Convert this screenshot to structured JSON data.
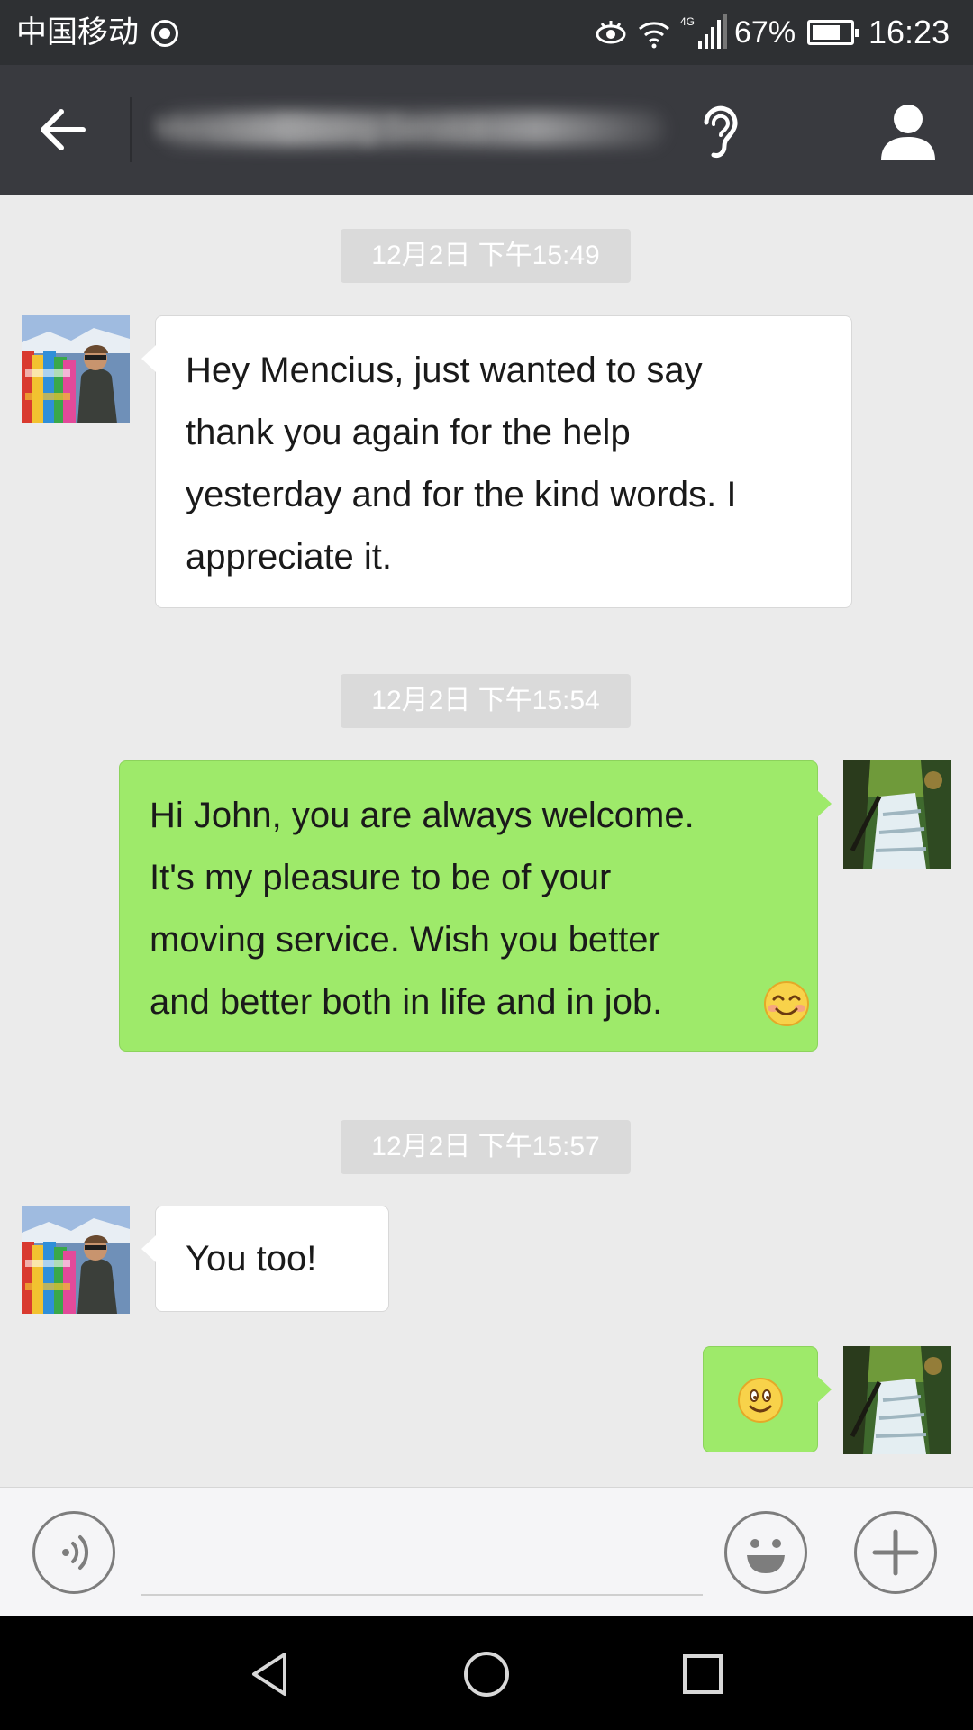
{
  "status_bar": {
    "carrier": "中国移动",
    "network": "4G",
    "battery": "67%",
    "time": "16:23"
  },
  "header": {
    "title": "Mencius Moving Service"
  },
  "messages": [
    {
      "timestamp": "12月2日 下午15:49",
      "from": "John",
      "side": "left",
      "text": "Hey Mencius, just wanted to say\nthank you again for the help\nyesterday and for the kind words. I\nappreciate it."
    },
    {
      "timestamp": "12月2日 下午15:54",
      "from": "me",
      "side": "right",
      "text": "Hi John, you are always welcome.\nIt's my pleasure to be of your\nmoving service. Wish you better\nand better both in life and in job.",
      "emoji": "smile"
    },
    {
      "timestamp": "12月2日 下午15:57",
      "from": "John",
      "side": "left",
      "text": "You too!"
    },
    {
      "from": "me",
      "side": "right",
      "emoji": "smile"
    }
  ],
  "input": {
    "placeholder": ""
  },
  "colors": {
    "status_bar_bg": "#2e3033",
    "header_bg": "#393a3f",
    "chat_bg": "#ebebeb",
    "outgoing_bubble": "#9eea6a",
    "incoming_bubble": "#ffffff",
    "timestamp_bg": "#dadada"
  },
  "icons": {
    "back": "arrow-left-icon",
    "earpiece": "ear-icon",
    "profile": "person-icon",
    "voice": "voice-icon",
    "emoji": "smiley-face-icon",
    "more": "plus-icon",
    "nav_back": "triangle-back-icon",
    "nav_home": "circle-home-icon",
    "nav_recents": "square-recents-icon"
  }
}
